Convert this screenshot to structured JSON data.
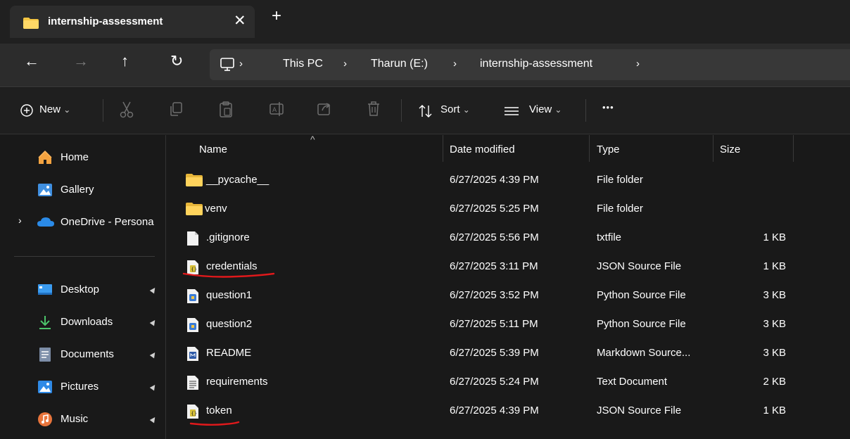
{
  "window": {
    "tab_title": "internship-assessment",
    "close_glyph": "✕",
    "new_tab_glyph": "+"
  },
  "nav": {
    "back": "←",
    "forward": "→",
    "up": "↑",
    "refresh": "↻",
    "breadcrumbs": [
      "This PC",
      "Tharun (E:)",
      "internship-assessment"
    ],
    "separator": "›"
  },
  "commands": {
    "new_label": "New",
    "sort_label": "Sort",
    "view_label": "View",
    "chevron": "⌄",
    "more": "•••"
  },
  "sidebar": {
    "items": [
      {
        "label": "Home",
        "icon": "home-icon"
      },
      {
        "label": "Gallery",
        "icon": "gallery-icon"
      },
      {
        "label": "OneDrive - Persona",
        "icon": "cloud-icon"
      },
      {
        "label": "Desktop",
        "icon": "desktop-icon",
        "pinned": true
      },
      {
        "label": "Downloads",
        "icon": "download-icon",
        "pinned": true
      },
      {
        "label": "Documents",
        "icon": "documents-icon",
        "pinned": true
      },
      {
        "label": "Pictures",
        "icon": "pictures-icon",
        "pinned": true
      },
      {
        "label": "Music",
        "icon": "music-icon",
        "pinned": true
      }
    ],
    "expander": "›",
    "pin_glyph": "📌"
  },
  "columns": {
    "name": "Name",
    "date": "Date modified",
    "type": "Type",
    "size": "Size",
    "sort_indicator": "^"
  },
  "files": [
    {
      "name": "__pycache__",
      "date": "6/27/2025 4:39 PM",
      "type": "File folder",
      "size": "",
      "icon": "folder-icon"
    },
    {
      "name": "venv",
      "date": "6/27/2025 5:25 PM",
      "type": "File folder",
      "size": "",
      "icon": "folder-icon"
    },
    {
      "name": ".gitignore",
      "date": "6/27/2025 5:56 PM",
      "type": "txtfile",
      "size": "1 KB",
      "icon": "file-icon"
    },
    {
      "name": "credentials",
      "date": "6/27/2025 3:11 PM",
      "type": "JSON Source File",
      "size": "1 KB",
      "icon": "json-file-icon",
      "underlined": true
    },
    {
      "name": "question1",
      "date": "6/27/2025 3:52 PM",
      "type": "Python Source File",
      "size": "3 KB",
      "icon": "python-file-icon"
    },
    {
      "name": "question2",
      "date": "6/27/2025 5:11 PM",
      "type": "Python Source File",
      "size": "3 KB",
      "icon": "python-file-icon"
    },
    {
      "name": "README",
      "date": "6/27/2025 5:39 PM",
      "type": "Markdown Source...",
      "size": "3 KB",
      "icon": "markdown-file-icon"
    },
    {
      "name": "requirements",
      "date": "6/27/2025 5:24 PM",
      "type": "Text Document",
      "size": "2 KB",
      "icon": "text-file-icon"
    },
    {
      "name": "token",
      "date": "6/27/2025 4:39 PM",
      "type": "JSON Source File",
      "size": "1 KB",
      "icon": "json-file-icon",
      "underlined": true
    }
  ],
  "colors": {
    "folder": "#f4c542",
    "annotation": "#e0191b",
    "accent": "#4aa8ff"
  }
}
